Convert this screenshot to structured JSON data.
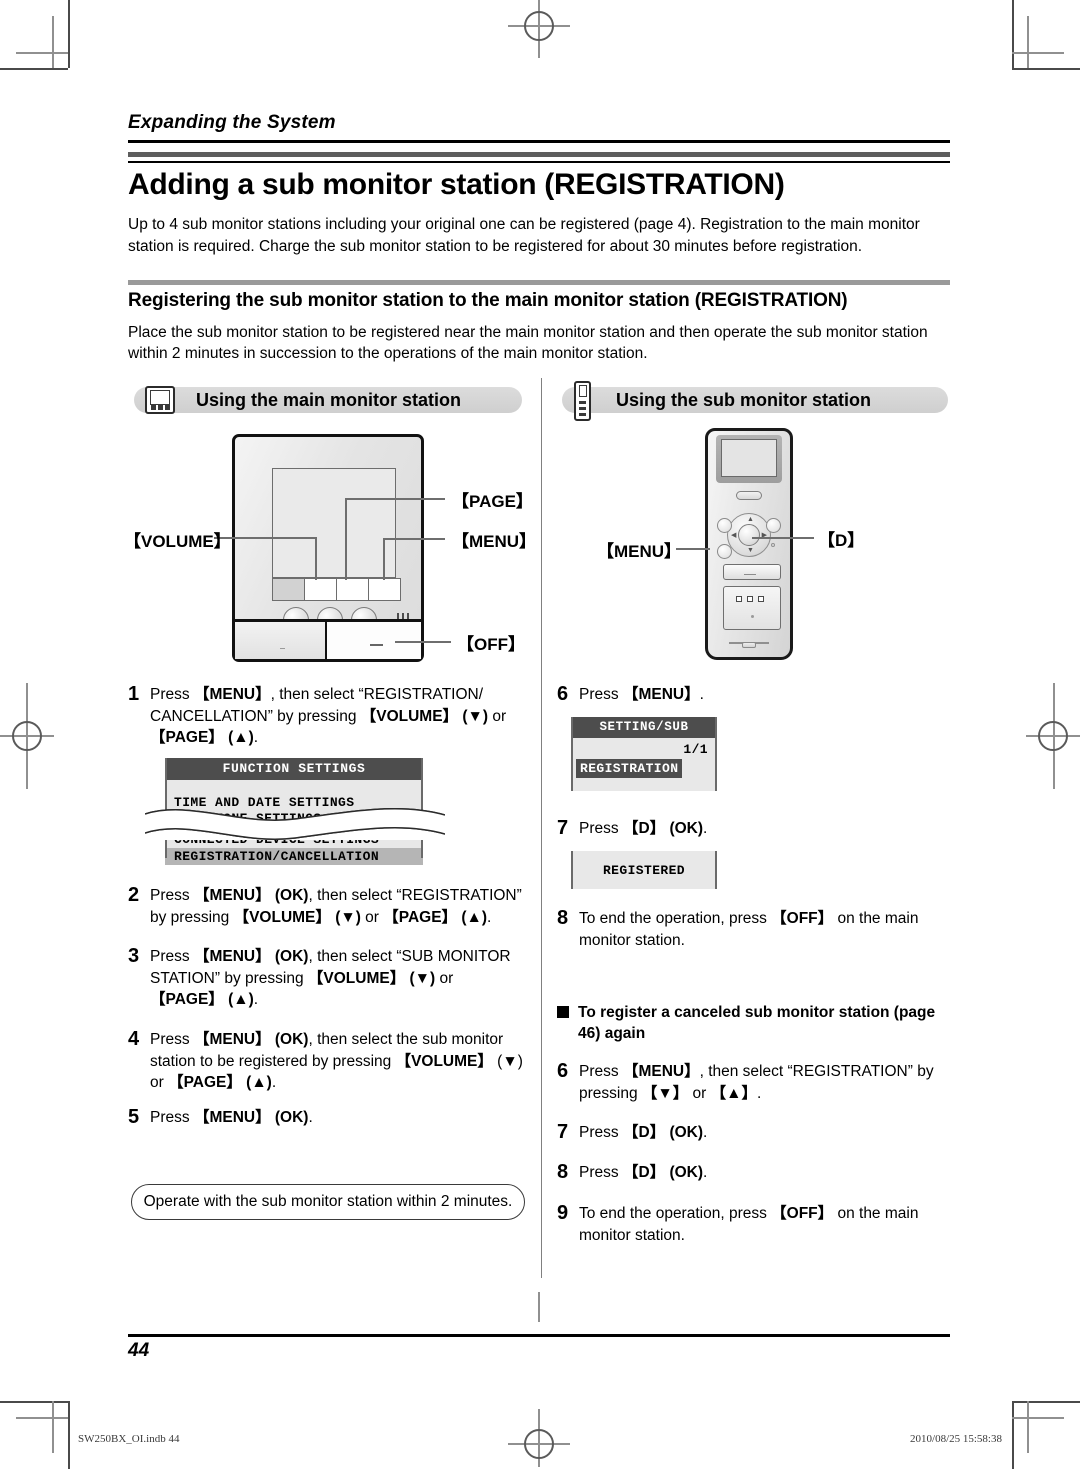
{
  "running_head": "Expanding the System",
  "title": "Adding a sub monitor station (REGISTRATION)",
  "intro": "Up to 4 sub monitor stations including your original one can be registered (page 4). Registration to the main monitor station is required. Charge the sub monitor station to be registered for about 30 minutes before registration.",
  "subsection": {
    "heading": "Registering the sub monitor station to the main monitor station (REGISTRATION)",
    "intro": "Place the sub monitor station to be registered near the main monitor station and then operate the sub monitor station within 2 minutes in succession to the operations of the main monitor station."
  },
  "columns": {
    "left": {
      "pill_label": "Using the main monitor station",
      "icon": "main-monitor-icon"
    },
    "right": {
      "pill_label": "Using the sub monitor station",
      "icon": "sub-monitor-icon"
    }
  },
  "callouts": {
    "volume": "【VOLUME】",
    "page": "【PAGE】",
    "menu": "【MENU】",
    "off": "【OFF】",
    "sub_menu": "【MENU】",
    "sub_d": "【D】"
  },
  "steps_left": [
    {
      "num": "1",
      "parts": [
        {
          "t": "Press ",
          "b": false
        },
        {
          "t": "【MENU】",
          "b": true
        },
        {
          "t": ", then select “REGISTRATION/CANCELLATION” by pressing ",
          "b": false
        },
        {
          "t": "【VOLUME】 (▼)",
          "b": true
        },
        {
          "t": " or ",
          "b": false
        },
        {
          "t": "【PAGE】 (▲)",
          "b": true
        },
        {
          "t": ".",
          "b": false
        }
      ]
    },
    {
      "num": "2",
      "parts": [
        {
          "t": "Press ",
          "b": false
        },
        {
          "t": "【MENU】 (OK)",
          "b": true
        },
        {
          "t": ", then select “REGISTRATION” by pressing ",
          "b": false
        },
        {
          "t": "【VOLUME】 (▼)",
          "b": true
        },
        {
          "t": " or ",
          "b": false
        },
        {
          "t": "【PAGE】 (▲)",
          "b": true
        },
        {
          "t": ".",
          "b": false
        }
      ]
    },
    {
      "num": "3",
      "parts": [
        {
          "t": "Press ",
          "b": false
        },
        {
          "t": "【MENU】 (OK)",
          "b": true
        },
        {
          "t": ", then select “SUB MONITOR STATION” by pressing ",
          "b": false
        },
        {
          "t": "【VOLUME】 (▼)",
          "b": true
        },
        {
          "t": " or ",
          "b": false
        },
        {
          "t": "【PAGE】 (▲)",
          "b": true
        },
        {
          "t": ".",
          "b": false
        }
      ]
    },
    {
      "num": "4",
      "parts": [
        {
          "t": "Press ",
          "b": false
        },
        {
          "t": "【MENU】 (OK)",
          "b": true
        },
        {
          "t": ", then select the sub monitor station to be registered by pressing ",
          "b": false
        },
        {
          "t": "【VOLUME】 (▼)",
          "b": true
        },
        {
          "t": " or ",
          "b": false
        },
        {
          "t": "【PAGE】 (▲)",
          "b": true
        },
        {
          "t": ".",
          "b": false
        }
      ]
    },
    {
      "num": "5",
      "parts": [
        {
          "t": "Press ",
          "b": false
        },
        {
          "t": "【MENU】 (OK)",
          "b": true
        },
        {
          "t": ".",
          "b": false
        }
      ]
    }
  ],
  "lcd_function_settings": {
    "title": "FUNCTION SETTINGS",
    "items": [
      "TIME AND DATE SETTINGS",
      "RING TONE SETTINGS",
      "CONNECTED DEVICE SETTINGS",
      "REGISTRATION/CANCELLATION"
    ],
    "highlighted": "REGISTRATION/CANCELLATION"
  },
  "note_box": "Operate with the sub monitor station within 2 minutes.",
  "steps_right": [
    {
      "num": "6",
      "parts": [
        {
          "t": "Press ",
          "b": false
        },
        {
          "t": "【MENU】",
          "b": true
        },
        {
          "t": ".",
          "b": false
        }
      ]
    },
    {
      "num": "7",
      "parts": [
        {
          "t": "Press ",
          "b": false
        },
        {
          "t": "【D】 (OK)",
          "b": true
        },
        {
          "t": ".",
          "b": false
        }
      ]
    },
    {
      "num": "8",
      "parts": [
        {
          "t": "To end the operation, press ",
          "b": false
        },
        {
          "t": "【OFF】",
          "b": true
        },
        {
          "t": " on the main monitor station.",
          "b": false
        }
      ]
    }
  ],
  "lcd_setting_sub": {
    "title": "SETTING/SUB",
    "page_indicator": "1/1",
    "highlighted": "REGISTRATION"
  },
  "lcd_registered": {
    "text": "REGISTERED"
  },
  "recancel": {
    "heading": "To register a canceled sub monitor station (page 46) again",
    "steps": [
      {
        "num": "6",
        "parts": [
          {
            "t": "Press ",
            "b": false
          },
          {
            "t": "【MENU】",
            "b": true
          },
          {
            "t": ", then select “REGISTRATION” by pressing ",
            "b": false
          },
          {
            "t": "【▼】",
            "b": true
          },
          {
            "t": " or ",
            "b": false
          },
          {
            "t": "【▲】",
            "b": true
          },
          {
            "t": ".",
            "b": false
          }
        ]
      },
      {
        "num": "7",
        "parts": [
          {
            "t": "Press ",
            "b": false
          },
          {
            "t": "【D】 (OK)",
            "b": true
          },
          {
            "t": ".",
            "b": false
          }
        ]
      },
      {
        "num": "8",
        "parts": [
          {
            "t": "Press ",
            "b": false
          },
          {
            "t": "【D】 (OK)",
            "b": true
          },
          {
            "t": ".",
            "b": false
          }
        ]
      },
      {
        "num": "9",
        "parts": [
          {
            "t": "To end the operation, press ",
            "b": false
          },
          {
            "t": "【OFF】",
            "b": true
          },
          {
            "t": " on the main monitor station.",
            "b": false
          }
        ]
      }
    ]
  },
  "footer": {
    "page_number": "44",
    "file_info": "SW250BX_OI.indb   44",
    "timestamp": "2010/08/25   15:58:38"
  }
}
